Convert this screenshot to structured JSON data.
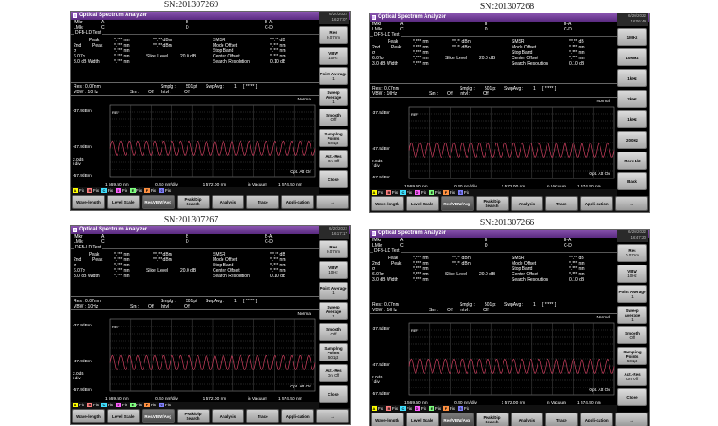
{
  "serials": [
    "SN:201307269",
    "SN:201307268",
    "SN:201307267",
    "SN:201307266"
  ],
  "dates": [
    "6/20/2022 16:27:07",
    "6/20/2022 16:06:49",
    "6/20/2022 16:17:17",
    "6/20/2022 16:47:20"
  ],
  "app_title": "Optical Spectrum Analyzer",
  "info": {
    "fmkr": "fMkr",
    "lmkr": "LMkr",
    "a": "A",
    "b": "B",
    "ba": "B-A",
    "c": "C",
    "d": "D",
    "cd": "C-D",
    "dfb": "DFB-LD Test",
    "peak": "Peak",
    "peak2": "2nd",
    "peak_lbl": "Peak",
    "sigma": "σ",
    "sigma_val": "6.07σ",
    "width_lbl": "3.0  dB Width",
    "nm_val": "*.*** nm",
    "nm_val2": "*.*** nm",
    "nm_val3": "*.*** nm",
    "nm_val4": "*.*** nm",
    "nm_val5": "*.*** nm",
    "dbm_val": "**.** dBm",
    "dbm_val2": "**.** dBm",
    "smsr": "SMSR",
    "mode_offset": "Mode Offset",
    "stop_band": "Stop Band",
    "center_offset": "Center Offset",
    "search_res": "Search Resolution",
    "db_val": "**.** dB",
    "nm_r1": "*.*** nm",
    "nm_r2": "*.*** nm",
    "nm_r3": "*.*** nm",
    "slice": "Slice Level",
    "slice_val": "20.0   dB",
    "search_res_val": "0.10  dB"
  },
  "res": {
    "res": "Res : 0.07nm",
    "vbw": "VBW : 10Hz",
    "sm": "Sm :",
    "sm_v": "Off",
    "smplg": "Smplg :",
    "smplg_v": "501pt",
    "intvl": "Intvl :",
    "intvl_v": "Off",
    "swpavg": "SwpAvg :",
    "swpavg_v": "1",
    "brk": "[  *****  ]"
  },
  "plot": {
    "y_top": "-37.9dBm",
    "y_mid": "-47.9dBm",
    "y_scale": "2.0dB\n/ div",
    "y_bot": "-57.9dBm",
    "ref": "REF",
    "normal": "Normal",
    "opt_att": "Opt. Att On",
    "x_left": "1 569.50 nm",
    "x_step": "0.50 nm/div",
    "x_center": "1 572.00 nm",
    "vac": "in Vacuum",
    "x_right": "1 574.50 nm"
  },
  "chart_data": {
    "type": "line",
    "x_range": [
      1569.5,
      1574.5
    ],
    "ylim": [
      -57.9,
      -37.9
    ],
    "series": [
      {
        "name": "",
        "pattern": "periodic-fringe",
        "center_dbm": -50.0,
        "amplitude_db": 2.0,
        "periods_across_screen": 24
      }
    ]
  },
  "traces": [
    {
      "label": "A",
      "state": "Fix",
      "color": "#ffff00"
    },
    {
      "label": "B",
      "state": "Fix",
      "color": "#ff8080"
    },
    {
      "label": "C",
      "state": "Fix",
      "color": "#40e0ff"
    },
    {
      "label": "D",
      "state": "Fix",
      "color": "#ff60ff"
    },
    {
      "label": "E",
      "state": "Fix",
      "color": "#80ff80"
    },
    {
      "label": "F",
      "state": "Fix",
      "color": "#ff9040"
    },
    {
      "label": "G",
      "state": "Fix",
      "color": "#8080ff"
    }
  ],
  "softkeys_left": [
    {
      "label": "Res",
      "value": "0.07nm"
    },
    {
      "label": "VBW",
      "value": "10Hz"
    },
    {
      "label": "Point Average",
      "value": "1"
    },
    {
      "label": "Sweep Average",
      "value": "1"
    },
    {
      "label": "Smooth",
      "value": "Off"
    },
    {
      "label": "Sampling Points",
      "value": "501pt"
    },
    {
      "label": "Act.-Res",
      "value": "On    Off"
    },
    {
      "label": "Close",
      "value": ""
    }
  ],
  "softkeys_right": [
    {
      "label": "1MHz",
      "value": ""
    },
    {
      "label": "10MHz",
      "value": ""
    },
    {
      "label": "1kHz",
      "value": ""
    },
    {
      "label": "2kHz",
      "value": ""
    },
    {
      "label": "1kHz",
      "value": ""
    },
    {
      "label": "200Hz",
      "value": ""
    },
    {
      "label": "More 1/2",
      "value": ""
    },
    {
      "label": "Back",
      "value": ""
    }
  ],
  "menu": [
    "Wave-length",
    "Level Scale",
    "Res/VBW/Avg",
    "Peak/Dip Search",
    "Analysis",
    "Trace",
    "Appli-cation",
    "→"
  ],
  "colors": {
    "trace": "#d04060",
    "grid": "#4a4a4a",
    "title": "#6a3a90"
  }
}
